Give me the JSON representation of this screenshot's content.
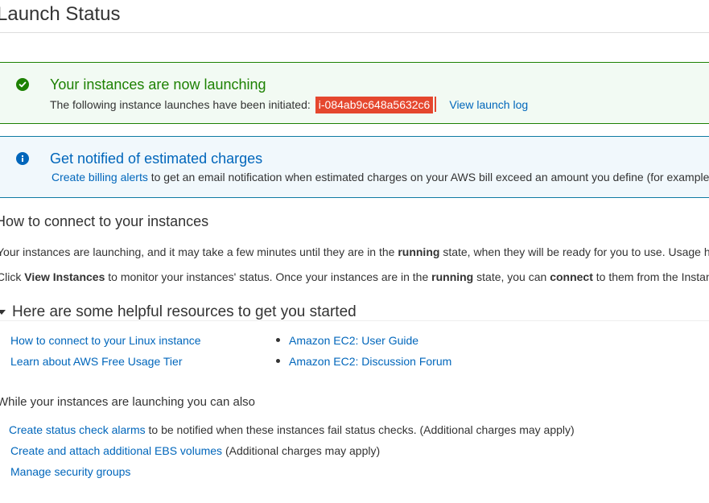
{
  "page": {
    "title": "Launch Status"
  },
  "success_alert": {
    "heading": "Your instances are now launching",
    "text": "The following instance launches have been initiated:",
    "instance_id": "i-084ab9c648a5632c6",
    "view_log_label": "View launch log"
  },
  "info_alert": {
    "heading": "Get notified of estimated charges",
    "link": "Create billing alerts",
    "text": "to get an email notification when estimated charges on your AWS bill exceed an amount you define (for example"
  },
  "connect": {
    "title": "How to connect to your instances",
    "p1_a": "Your instances are launching, and it may take a few minutes until they are in the",
    "p1_b": "running",
    "p1_c": "state, when they will be ready for you to use. Usage ho",
    "p2_a": "Click",
    "p2_b": "View Instances",
    "p2_c": "to monitor your instances' status. Once your instances are in the",
    "p2_d": "running",
    "p2_e": "state, you can",
    "p2_f": "connect",
    "p2_g": "to them from the Instanc"
  },
  "resources": {
    "title": "Here are some helpful resources to get you started",
    "col1": [
      "How to connect to your Linux instance",
      "Learn about AWS Free Usage Tier"
    ],
    "col2": [
      "Amazon EC2: User Guide",
      "Amazon EC2: Discussion Forum"
    ]
  },
  "also": {
    "title": "While your instances are launching you can also",
    "items": [
      {
        "link": "Create status check alarms",
        "text": "to be notified when these instances fail status checks. (Additional charges may apply)"
      },
      {
        "link": "Create and attach additional EBS volumes",
        "text": "(Additional charges may apply)"
      },
      {
        "link": "Manage security groups",
        "text": ""
      }
    ]
  },
  "colors": {
    "success": "#1d8102",
    "info": "#0066bb",
    "highlight": "#e5472e",
    "link": "#0066bb"
  },
  "icons": {
    "success": "check-circle-icon",
    "info": "info-circle-icon",
    "expand": "caret-down-icon"
  }
}
